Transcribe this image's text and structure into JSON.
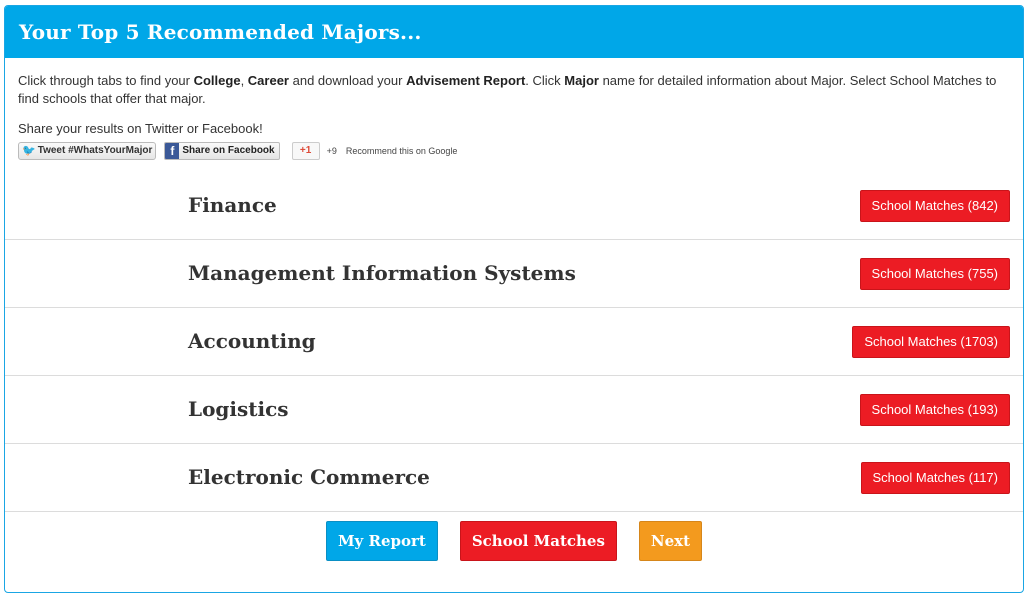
{
  "header": {
    "title": "Your Top 5 Recommended Majors..."
  },
  "intro": {
    "p1": "Click through tabs to find your ",
    "college": "College",
    "sep1": ", ",
    "career": "Career",
    "p2": " and download your ",
    "report": "Advisement Report",
    "p3": ". Click ",
    "major": "Major",
    "p4": " name for detailed information about Major. Select School Matches to find schools that offer that major."
  },
  "share": {
    "line": "Share your results on Twitter or Facebook!",
    "tweet_label": "Tweet #WhatsYourMajor",
    "facebook_label": "Share on Facebook",
    "gplus_label": "+1",
    "gplus_count": "+9",
    "gplus_text": "Recommend this on Google"
  },
  "majors": [
    {
      "name": "Finance",
      "matches": "School Matches (842)"
    },
    {
      "name": "Management Information Systems",
      "matches": "School Matches (755)"
    },
    {
      "name": "Accounting",
      "matches": "School Matches (1703)"
    },
    {
      "name": "Logistics",
      "matches": "School Matches (193)"
    },
    {
      "name": "Electronic Commerce",
      "matches": "School Matches (117)"
    }
  ],
  "actions": {
    "report": "My Report",
    "matches": "School Matches",
    "next": "Next"
  },
  "colors": {
    "header_bg": "#00a7e8",
    "matches_red": "#ec1c24",
    "next_orange": "#f39a1e"
  }
}
